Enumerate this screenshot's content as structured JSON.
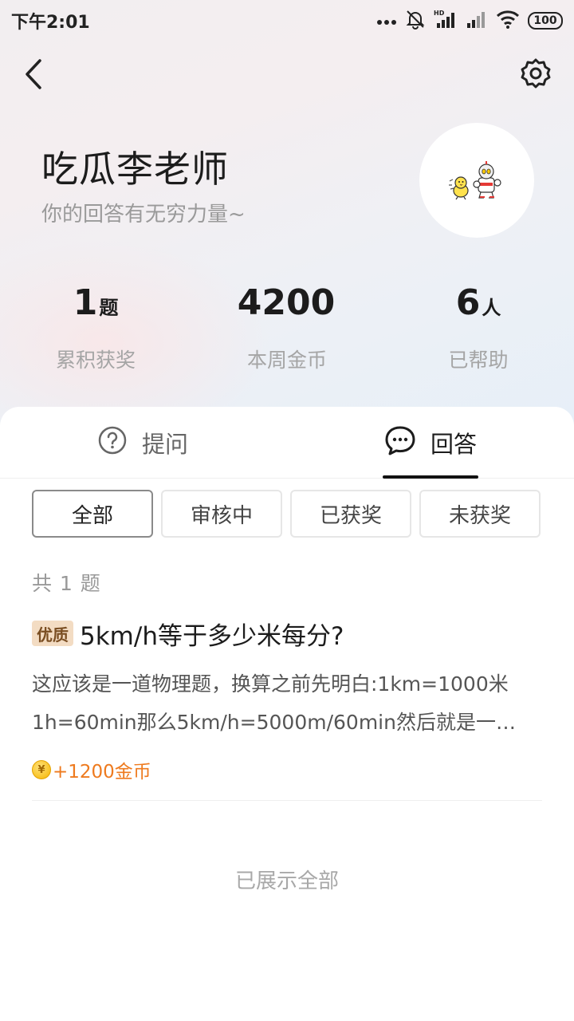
{
  "status_bar": {
    "time": "下午2:01",
    "battery": "100"
  },
  "header": {
    "back_icon": "chevron-left-icon",
    "settings_icon": "gear-icon"
  },
  "profile": {
    "name": "吃瓜李老师",
    "motto": "你的回答有无穷力量~"
  },
  "stats": [
    {
      "value": "1",
      "unit": "题",
      "label": "累积获奖"
    },
    {
      "value": "4200",
      "unit": "",
      "label": "本周金币"
    },
    {
      "value": "6",
      "unit": "人",
      "label": "已帮助"
    }
  ],
  "tabs": [
    {
      "label": "提问",
      "icon": "question-circle-icon",
      "active": false
    },
    {
      "label": "回答",
      "icon": "chat-bubble-icon",
      "active": true
    }
  ],
  "filters": [
    {
      "label": "全部",
      "active": true
    },
    {
      "label": "审核中",
      "active": false
    },
    {
      "label": "已获奖",
      "active": false
    },
    {
      "label": "未获奖",
      "active": false
    }
  ],
  "list": {
    "count_text": "共 1 题",
    "items": [
      {
        "badge": "优质",
        "title": "5km/h等于多少米每分?",
        "snippet": "这应该是一道物理题，换算之前先明白:1km=1000米1h=60min那么5km/h=5000m/60min然后就是一…",
        "reward": "+1200金币"
      }
    ],
    "end_text": "已展示全部"
  },
  "colors": {
    "accent_orange": "#ee7a1e",
    "badge_bg": "#f3dcc3",
    "coin_gold": "#f5b400"
  }
}
